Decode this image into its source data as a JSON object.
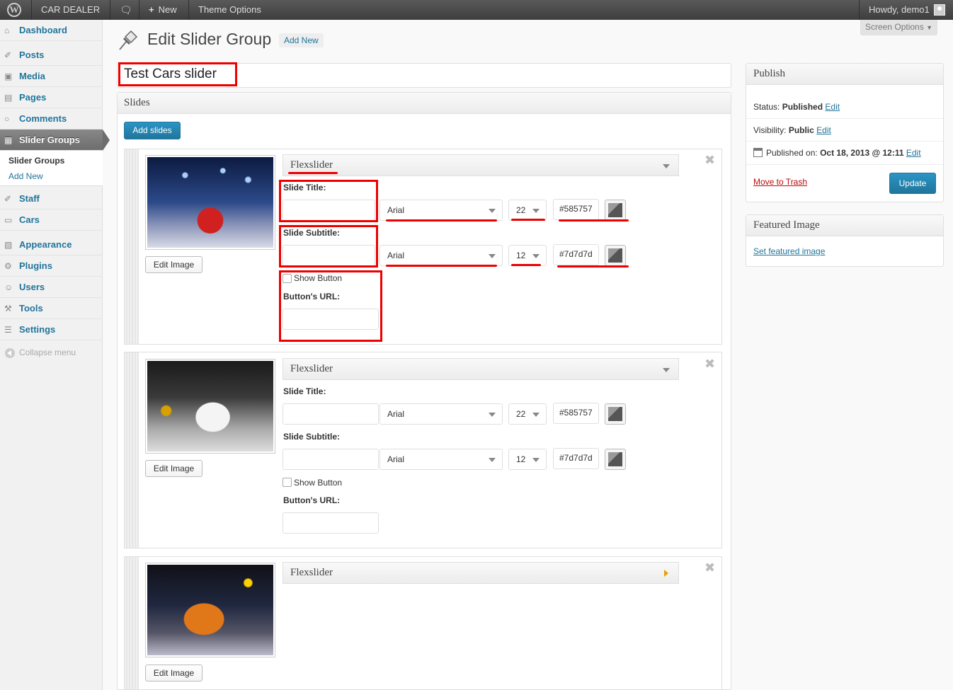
{
  "adminbar": {
    "site_name": "CAR DEALER",
    "new_label": "New",
    "theme_options": "Theme Options",
    "howdy": "Howdy, demo1"
  },
  "screen_options": "Screen Options",
  "sidebar": {
    "items": [
      {
        "label": "Dashboard",
        "icon": "dashboard-icon"
      },
      {
        "label": "Posts",
        "icon": "pin-icon"
      },
      {
        "label": "Media",
        "icon": "media-icon"
      },
      {
        "label": "Pages",
        "icon": "pages-icon"
      },
      {
        "label": "Comments",
        "icon": "comment-icon"
      },
      {
        "label": "Slider Groups",
        "icon": "slider-icon"
      },
      {
        "label": "Staff",
        "icon": "pin-icon"
      },
      {
        "label": "Cars",
        "icon": "car-icon"
      },
      {
        "label": "Appearance",
        "icon": "appearance-icon"
      },
      {
        "label": "Plugins",
        "icon": "plugin-icon"
      },
      {
        "label": "Users",
        "icon": "users-icon"
      },
      {
        "label": "Tools",
        "icon": "tools-icon"
      },
      {
        "label": "Settings",
        "icon": "settings-icon"
      }
    ],
    "submenu": [
      "Slider Groups",
      "Add New"
    ],
    "collapse": "Collapse menu"
  },
  "page": {
    "title": "Edit Slider Group",
    "add_new": "Add New",
    "post_title": "Test Cars slider"
  },
  "slides_box": {
    "title": "Slides",
    "add_button": "Add slides"
  },
  "slides": [
    {
      "effect": "Flexslider",
      "title_label": "Slide Title:",
      "subtitle_label": "Slide Subtitle:",
      "title_font": "Arial",
      "title_size": "22",
      "title_color": "#585757",
      "subtitle_font": "Arial",
      "subtitle_size": "12",
      "subtitle_color": "#7d7d7d",
      "show_button": "Show Button",
      "url_label": "Button's URL:",
      "edit_image": "Edit Image"
    },
    {
      "effect": "Flexslider",
      "title_label": "Slide Title:",
      "subtitle_label": "Slide Subtitle:",
      "title_font": "Arial",
      "title_size": "22",
      "title_color": "#585757",
      "subtitle_font": "Arial",
      "subtitle_size": "12",
      "subtitle_color": "#7d7d7d",
      "show_button": "Show Button",
      "url_label": "Button's URL:",
      "edit_image": "Edit Image"
    },
    {
      "effect": "Flexslider",
      "edit_image": "Edit Image"
    }
  ],
  "publish": {
    "title": "Publish",
    "status_label": "Status:",
    "status_value": "Published",
    "visibility_label": "Visibility:",
    "visibility_value": "Public",
    "published_label": "Published on:",
    "published_value": "Oct 18, 2013 @ 12:11",
    "edit": "Edit",
    "trash": "Move to Trash",
    "update": "Update"
  },
  "featured": {
    "title": "Featured Image",
    "link": "Set featured image"
  },
  "colors": {
    "accent": "#21759b",
    "annotation": "#e00000"
  }
}
